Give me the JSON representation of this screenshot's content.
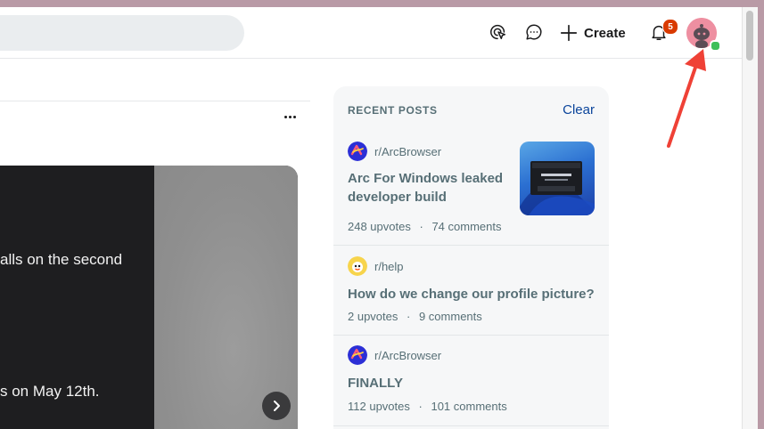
{
  "header": {
    "create_label": "Create",
    "notification_count": "5",
    "icons": [
      "advertise-icon",
      "chat-icon",
      "plus-icon",
      "bell-icon"
    ]
  },
  "post": {
    "media_line_1": "alls on the second",
    "media_line_2": "s on May 12th."
  },
  "recent_posts": {
    "title": "RECENT POSTS",
    "clear_label": "Clear",
    "items": [
      {
        "subreddit": "r/ArcBrowser",
        "title_line_1": "Arc For Windows leaked",
        "title_line_2": "developer build",
        "upvotes": "248 upvotes",
        "comments": "74 comments"
      },
      {
        "subreddit": "r/help",
        "title_line_1": "How do we change our profile picture?",
        "upvotes": "2 upvotes",
        "comments": "9 comments"
      },
      {
        "subreddit": "r/ArcBrowser",
        "title_line_1": "FINALLY",
        "upvotes": "112 upvotes",
        "comments": "101 comments"
      }
    ],
    "separator": "·"
  },
  "colors": {
    "accent_arrow": "#ef4136",
    "badge": "#d93a00",
    "link": "#0a449b",
    "online": "#3fbf5a"
  }
}
